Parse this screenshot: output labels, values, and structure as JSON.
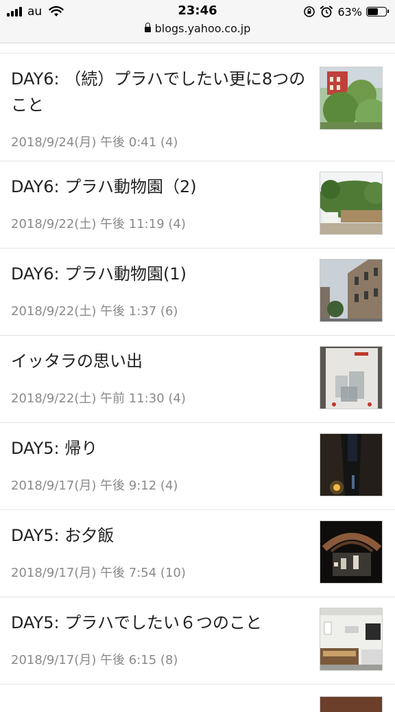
{
  "status_bar": {
    "carrier": "au",
    "time": "23:46",
    "battery_percent": "63%",
    "battery_level": 0.63,
    "url": "blogs.yahoo.co.jp"
  },
  "posts": [
    {
      "title": "DAY6: （続）プラハでしたい更に8つのこと",
      "meta": "2018/9/24(月) 午後 0:41 (4)",
      "thumbnail_icon": "photo-building-trees"
    },
    {
      "title": "DAY6: プラハ動物園（2)",
      "meta": "2018/9/22(土) 午後 11:19 (4)",
      "thumbnail_icon": "photo-zoo-hill"
    },
    {
      "title": "DAY6: プラハ動物園(1)",
      "meta": "2018/9/22(土) 午後 1:37 (6)",
      "thumbnail_icon": "photo-street-building"
    },
    {
      "title": "イッタラの思い出",
      "meta": "2018/9/22(土) 午前 11:30 (4)",
      "thumbnail_icon": "photo-glassware-bag"
    },
    {
      "title": "DAY5: 帰り",
      "meta": "2018/9/17(月) 午後 9:12 (4)",
      "thumbnail_icon": "photo-night-street"
    },
    {
      "title": "DAY5: お夕飯",
      "meta": "2018/9/17(月) 午後 7:54 (10)",
      "thumbnail_icon": "photo-dark-restaurant"
    },
    {
      "title": "DAY5: プラハでしたい６つのこと",
      "meta": "2018/9/17(月) 午後 6:15 (8)",
      "thumbnail_icon": "photo-cafe-interior"
    }
  ]
}
